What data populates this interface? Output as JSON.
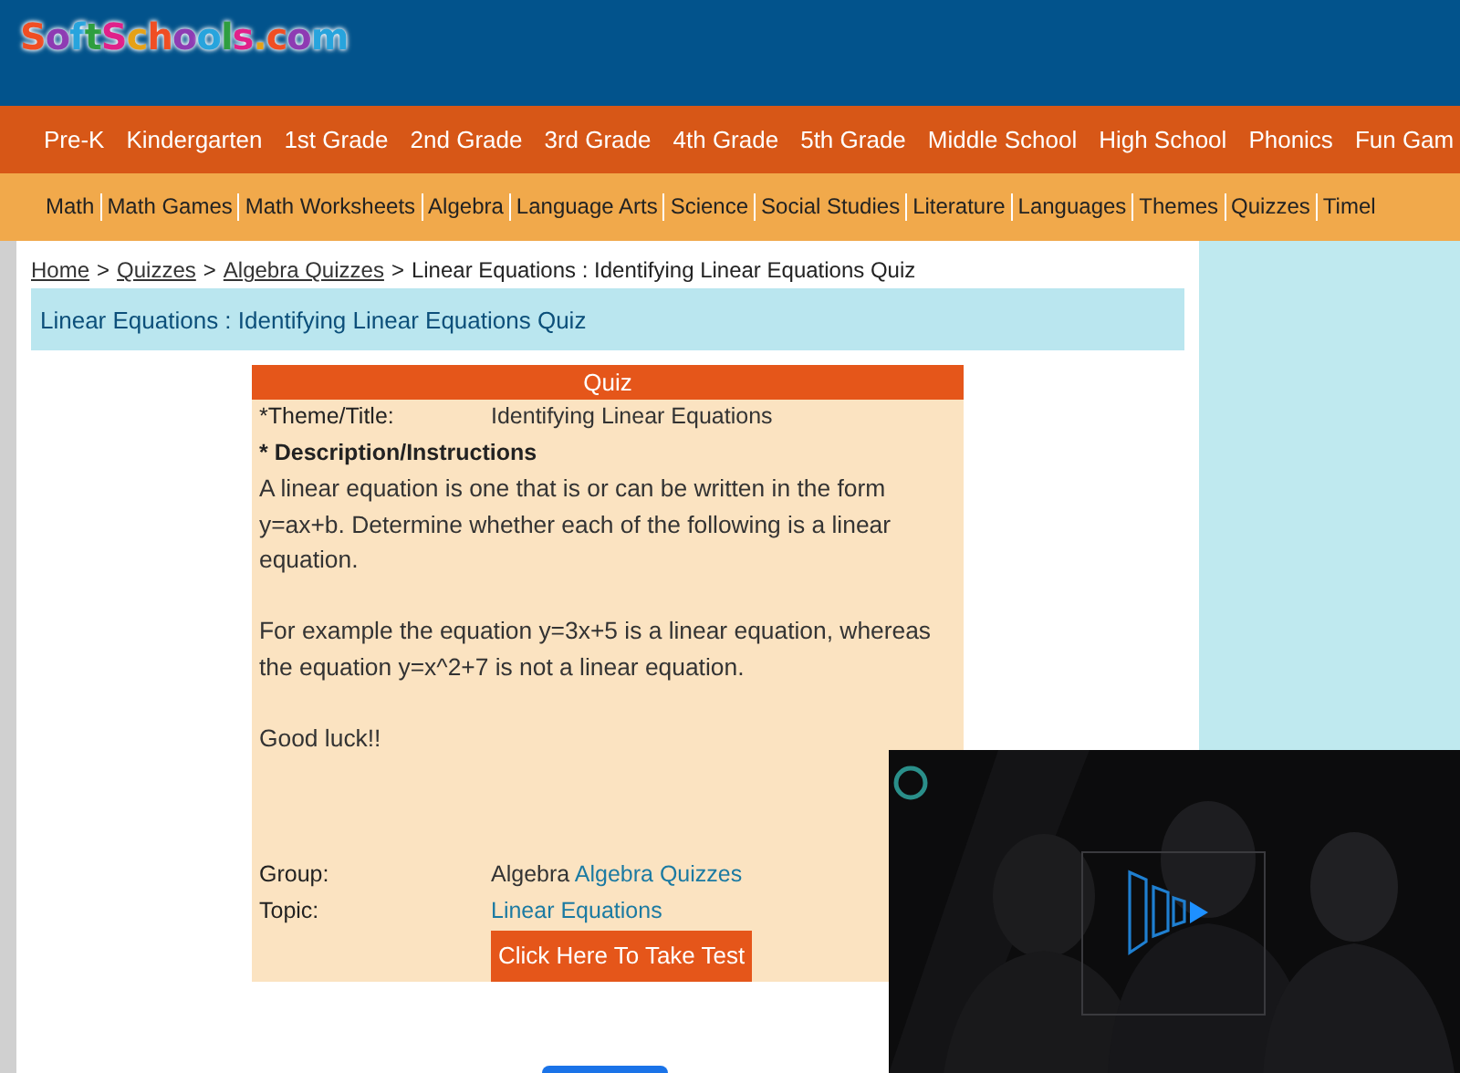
{
  "logo": "SoftSchools.com",
  "grade_nav": [
    "Pre-K",
    "Kindergarten",
    "1st Grade",
    "2nd Grade",
    "3rd Grade",
    "4th Grade",
    "5th Grade",
    "Middle School",
    "High School",
    "Phonics",
    "Fun Gam"
  ],
  "subject_nav": [
    "Math",
    "Math Games",
    "Math Worksheets",
    "Algebra",
    "Language Arts",
    "Science",
    "Social Studies",
    "Literature",
    "Languages",
    "Themes",
    "Quizzes",
    "Timel"
  ],
  "breadcrumb": [
    {
      "text": "Home",
      "kind": "link"
    },
    {
      "text": ">",
      "kind": "sep"
    },
    {
      "text": "Quizzes",
      "kind": "link"
    },
    {
      "text": ">",
      "kind": "sep"
    },
    {
      "text": "Algebra Quizzes",
      "kind": "link"
    },
    {
      "text": ">",
      "kind": "sep"
    },
    {
      "text": "Linear Equations : Identifying Linear Equations Quiz",
      "kind": "current"
    }
  ],
  "page_title": "Linear Equations : Identifying Linear Equations Quiz",
  "quiz": {
    "header": "Quiz",
    "theme_label": "*Theme/Title:",
    "theme_value": "Identifying Linear Equations",
    "description_label": "* Description/Instructions",
    "paragraphs": [
      "A linear equation is one that is or can be written in the form y=ax+b. Determine whether each of the following is a linear equation.",
      "For example the equation y=3x+5 is a linear equation, whereas the equation y=x^2+7 is not a linear equation.",
      "Good luck!!"
    ],
    "group_label": "Group:",
    "group_value": "Algebra",
    "group_link": "Algebra Quizzes",
    "topic_label": "Topic:",
    "topic_link": "Linear Equations",
    "test_button": "Click Here To Take Test"
  },
  "video": {
    "kind": "picture"
  }
}
